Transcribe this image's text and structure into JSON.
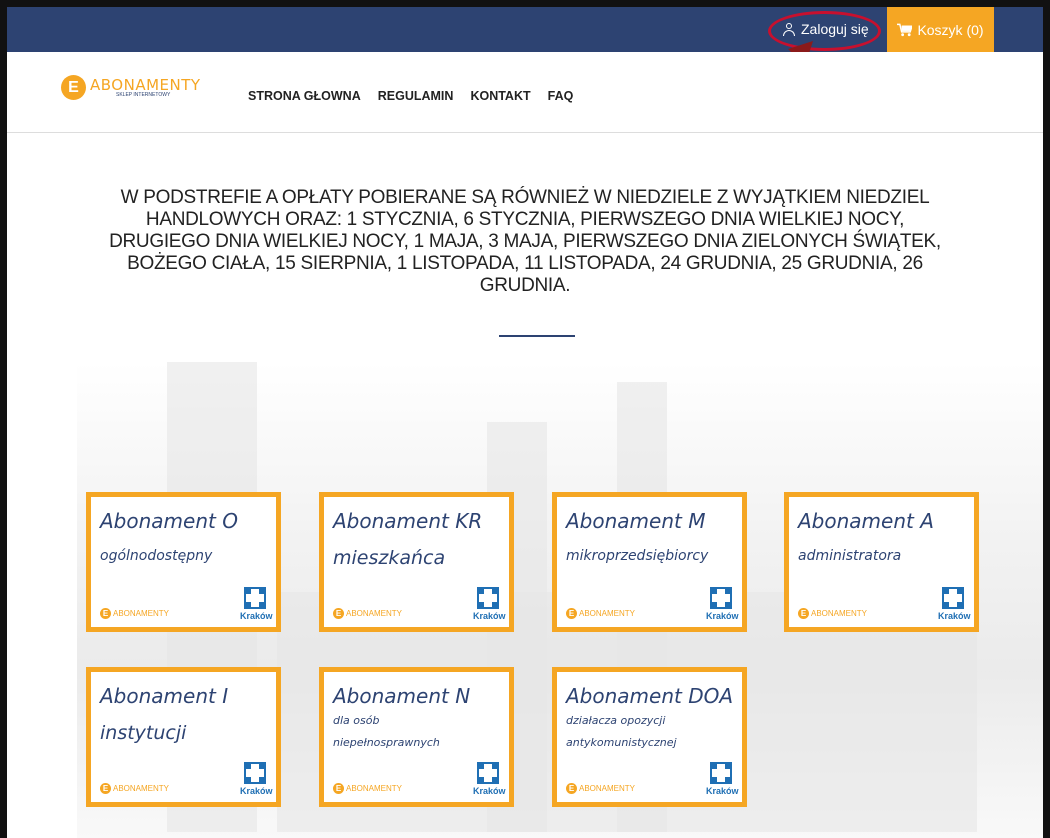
{
  "topbar": {
    "login_label": "Zaloguj się",
    "cart_label": "Koszyk (0)"
  },
  "logo": {
    "main": "ABONAMENTY",
    "sub": "SKLEP INTERNETOWY",
    "letter": "E"
  },
  "nav": [
    "STRONA GŁOWNA",
    "REGULAMIN",
    "KONTAKT",
    "FAQ"
  ],
  "headline": "W PODSTREFIE A OPŁATY POBIERANE SĄ RÓWNIEŻ W NIEDZIELE Z WYJĄTKIEM NIEDZIEL HANDLOWYCH ORAZ: 1 STYCZNIA, 6 STYCZNIA, PIERWSZEGO DNIA WIELKIEJ NOCY, DRUGIEGO DNIA WIELKIEJ NOCY, 1 MAJA, 3 MAJA, PIERWSZEGO DNIA ZIELONYCH ŚWIĄTEK, BOŻEGO CIAŁA, 15 SIERPNIA, 1 LISTOPADA, 11 LISTOPADA, 24 GRUDNIA, 25 GRUDNIA, 26 GRUDNIA.",
  "cards": [
    {
      "title": "Abonament O",
      "subtitle": "ogólnodostępny"
    },
    {
      "title": "Abonament KR",
      "subtitle": "mieszkańca"
    },
    {
      "title": "Abonament M",
      "subtitle": "mikroprzedsiębiorcy"
    },
    {
      "title": "Abonament A",
      "subtitle": "administratora"
    },
    {
      "title": "Abonament I",
      "subtitle": "instytucji"
    },
    {
      "title": "Abonament N",
      "subtitle": "dla osób niepełnosprawnych"
    },
    {
      "title": "Abonament DOA",
      "subtitle": "działacza opozycji antykomunistycznej"
    }
  ],
  "card_city": "Kraków",
  "card_logo_text": "ABONAMENTY",
  "colors": {
    "topbar": "#2d4372",
    "accent": "#f5a623",
    "highlight": "#c8102e"
  }
}
